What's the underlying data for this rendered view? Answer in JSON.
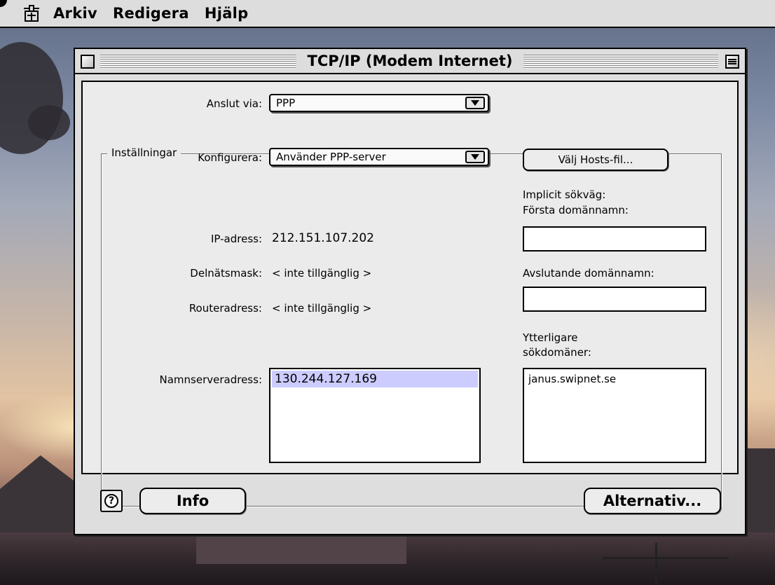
{
  "menubar": {
    "items": [
      "Arkiv",
      "Redigera",
      "Hjälp"
    ]
  },
  "window": {
    "title": "TCP/IP (Modem Internet)"
  },
  "connect": {
    "label": "Anslut via:",
    "value": "PPP"
  },
  "settings": {
    "group_label": "Inställningar",
    "configure_label": "Konfigurera:",
    "configure_value": "Använder PPP-server",
    "hosts_button": "Välj Hosts-fil...",
    "ip_label": "IP-adress:",
    "ip_value": "212.151.107.202",
    "subnet_label": "Delnätsmask:",
    "subnet_value": "< inte tillgänglig >",
    "router_label": "Routeradress:",
    "router_value": "< inte tillgänglig >",
    "nameserver_label": "Namnserveradress:",
    "nameservers": [
      "130.244.127.169"
    ],
    "implicit_search_label": "Implicit sökväg:",
    "first_domain_label": "Första domännamn:",
    "first_domain_value": "",
    "trailing_domain_label": "Avslutande domännamn:",
    "trailing_domain_value": "",
    "extra_domains_label_line1": "Ytterligare",
    "extra_domains_label_line2": "sökdomäner:",
    "extra_domains": [
      "janus.swipnet.se"
    ]
  },
  "footer": {
    "help_glyph": "?",
    "info_button": "Info",
    "options_button": "Alternativ..."
  },
  "colors": {
    "menubar_bg": "#dddddd",
    "window_bg": "#dedede",
    "panel_bg": "#ebebeb",
    "selection": "#ccccff"
  }
}
